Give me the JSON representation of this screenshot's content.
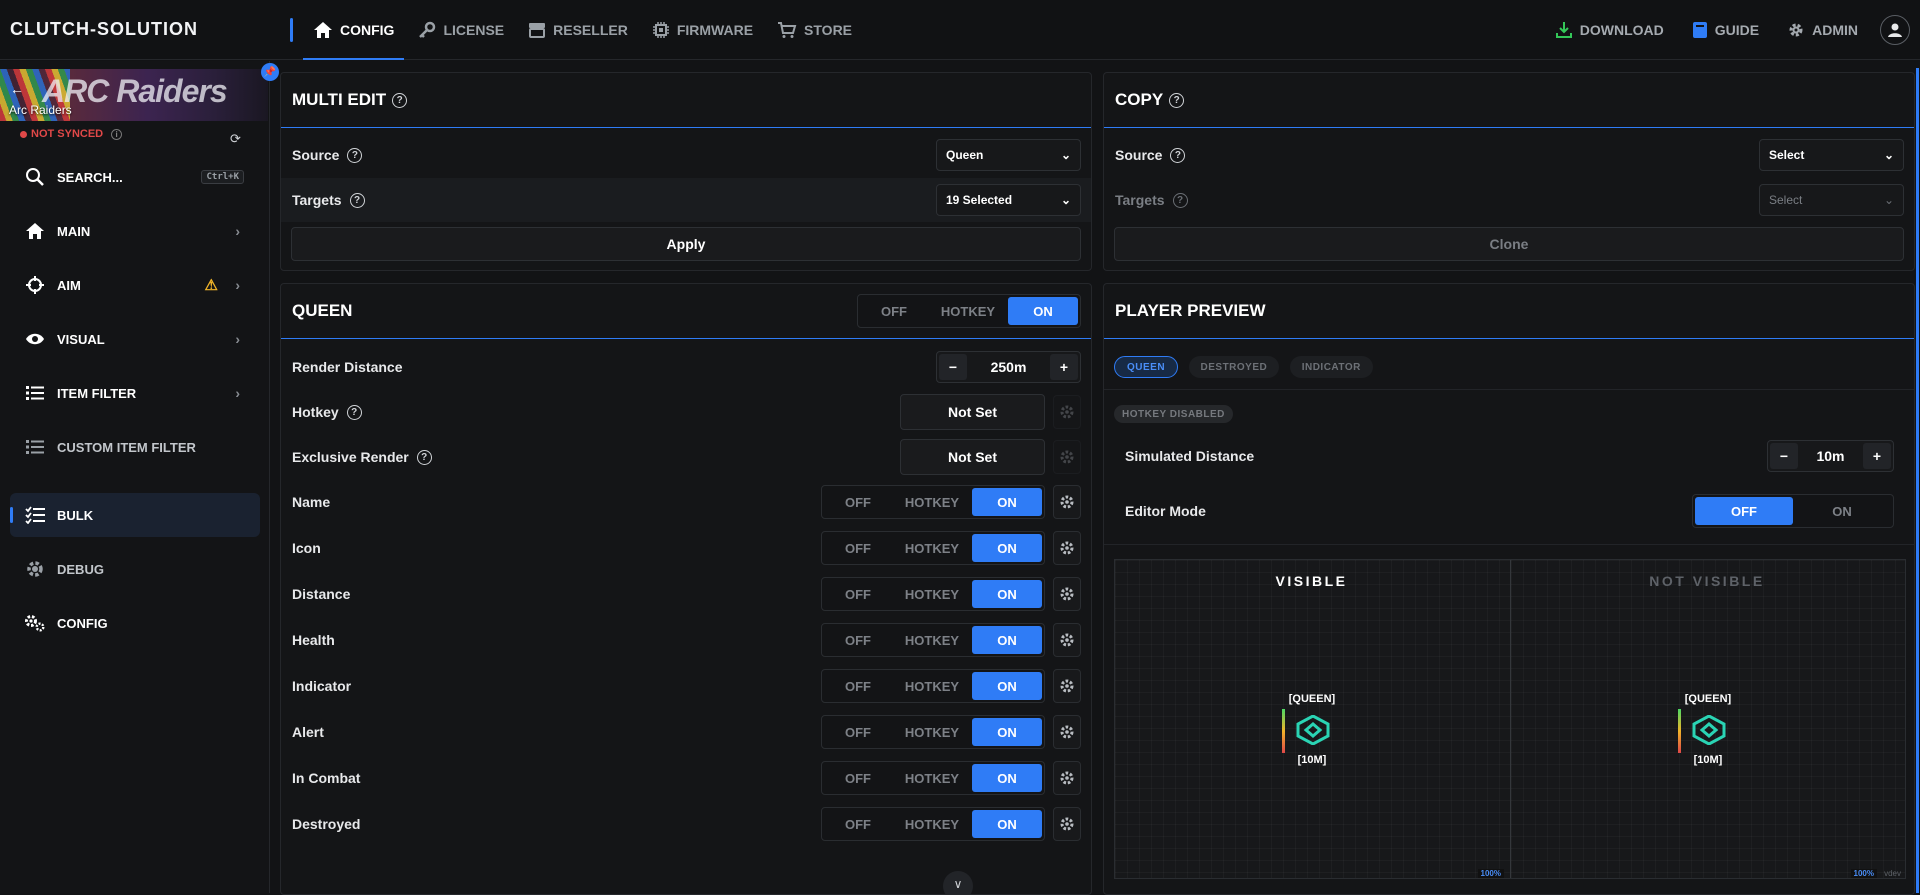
{
  "brand": "CLUTCH-SOLUTION",
  "nav": {
    "items": [
      {
        "label": "CONFIG",
        "icon": "home-icon",
        "active": true
      },
      {
        "label": "LICENSE",
        "icon": "key-icon"
      },
      {
        "label": "RESELLER",
        "icon": "store-icon"
      },
      {
        "label": "FIRMWARE",
        "icon": "chip-icon"
      },
      {
        "label": "STORE",
        "icon": "cart-icon"
      }
    ],
    "right": [
      {
        "label": "DOWNLOAD",
        "icon": "download-icon",
        "color": "#34c759"
      },
      {
        "label": "GUIDE",
        "icon": "book-icon",
        "color": "#2f7cf6"
      },
      {
        "label": "ADMIN",
        "icon": "gear-icon"
      }
    ]
  },
  "sidebar": {
    "game_logo": "ARC Raiders",
    "game_name": "Arc Raiders",
    "sync_status": "NOT SYNCED",
    "search_label": "SEARCH...",
    "search_shortcut": "Ctrl+K",
    "items": [
      {
        "label": "MAIN",
        "icon": "home-icon",
        "chevron": true
      },
      {
        "label": "AIM",
        "icon": "crosshair-icon",
        "chevron": true,
        "warning": true
      },
      {
        "label": "VISUAL",
        "icon": "eye-icon",
        "chevron": true
      },
      {
        "label": "ITEM FILTER",
        "icon": "list-icon",
        "chevron": true
      },
      {
        "label": "CUSTOM ITEM FILTER",
        "icon": "list-icon"
      },
      {
        "label": "BULK",
        "icon": "checklist-icon",
        "active": true
      },
      {
        "label": "DEBUG",
        "icon": "gear-icon"
      },
      {
        "label": "CONFIG",
        "icon": "gears-icon"
      }
    ]
  },
  "multi_edit": {
    "title": "MULTI EDIT",
    "source_label": "Source",
    "source_value": "Queen",
    "targets_label": "Targets",
    "targets_value": "19 Selected",
    "apply_label": "Apply"
  },
  "copy": {
    "title": "COPY",
    "source_label": "Source",
    "source_value": "Select",
    "targets_label": "Targets",
    "targets_value": "Select",
    "clone_label": "Clone"
  },
  "queen": {
    "title": "QUEEN",
    "mode_options": [
      "OFF",
      "HOTKEY",
      "ON"
    ],
    "mode_selected": "ON",
    "render_distance_label": "Render Distance",
    "render_distance_value": "250m",
    "hotkey_label": "Hotkey",
    "hotkey_value": "Not Set",
    "exclusive_label": "Exclusive Render",
    "exclusive_value": "Not Set",
    "toggles": [
      {
        "label": "Name",
        "selected": "ON"
      },
      {
        "label": "Icon",
        "selected": "ON"
      },
      {
        "label": "Distance",
        "selected": "ON"
      },
      {
        "label": "Health",
        "selected": "ON"
      },
      {
        "label": "Indicator",
        "selected": "ON"
      },
      {
        "label": "Alert",
        "selected": "ON"
      },
      {
        "label": "In Combat",
        "selected": "ON"
      },
      {
        "label": "Destroyed",
        "selected": "ON"
      }
    ]
  },
  "preview": {
    "title": "PLAYER PREVIEW",
    "tabs": [
      {
        "label": "QUEEN",
        "active": true
      },
      {
        "label": "DESTROYED"
      },
      {
        "label": "INDICATOR"
      }
    ],
    "hotkey_badge": "HOTKEY DISABLED",
    "simulated_label": "Simulated Distance",
    "simulated_value": "10m",
    "editor_label": "Editor Mode",
    "editor_options": [
      "OFF",
      "ON"
    ],
    "editor_selected": "OFF",
    "visible_label": "VISIBLE",
    "not_visible_label": "NOT VISIBLE",
    "esp_name": "[QUEEN]",
    "esp_distance": "[10M]",
    "zoom_left": "100%",
    "zoom_right": "100%",
    "footer_tag": "vdev"
  },
  "colors": {
    "accent": "#2f7cf6",
    "warning": "#f0b429",
    "danger": "#e04848",
    "esp": "#2ad4b4"
  }
}
